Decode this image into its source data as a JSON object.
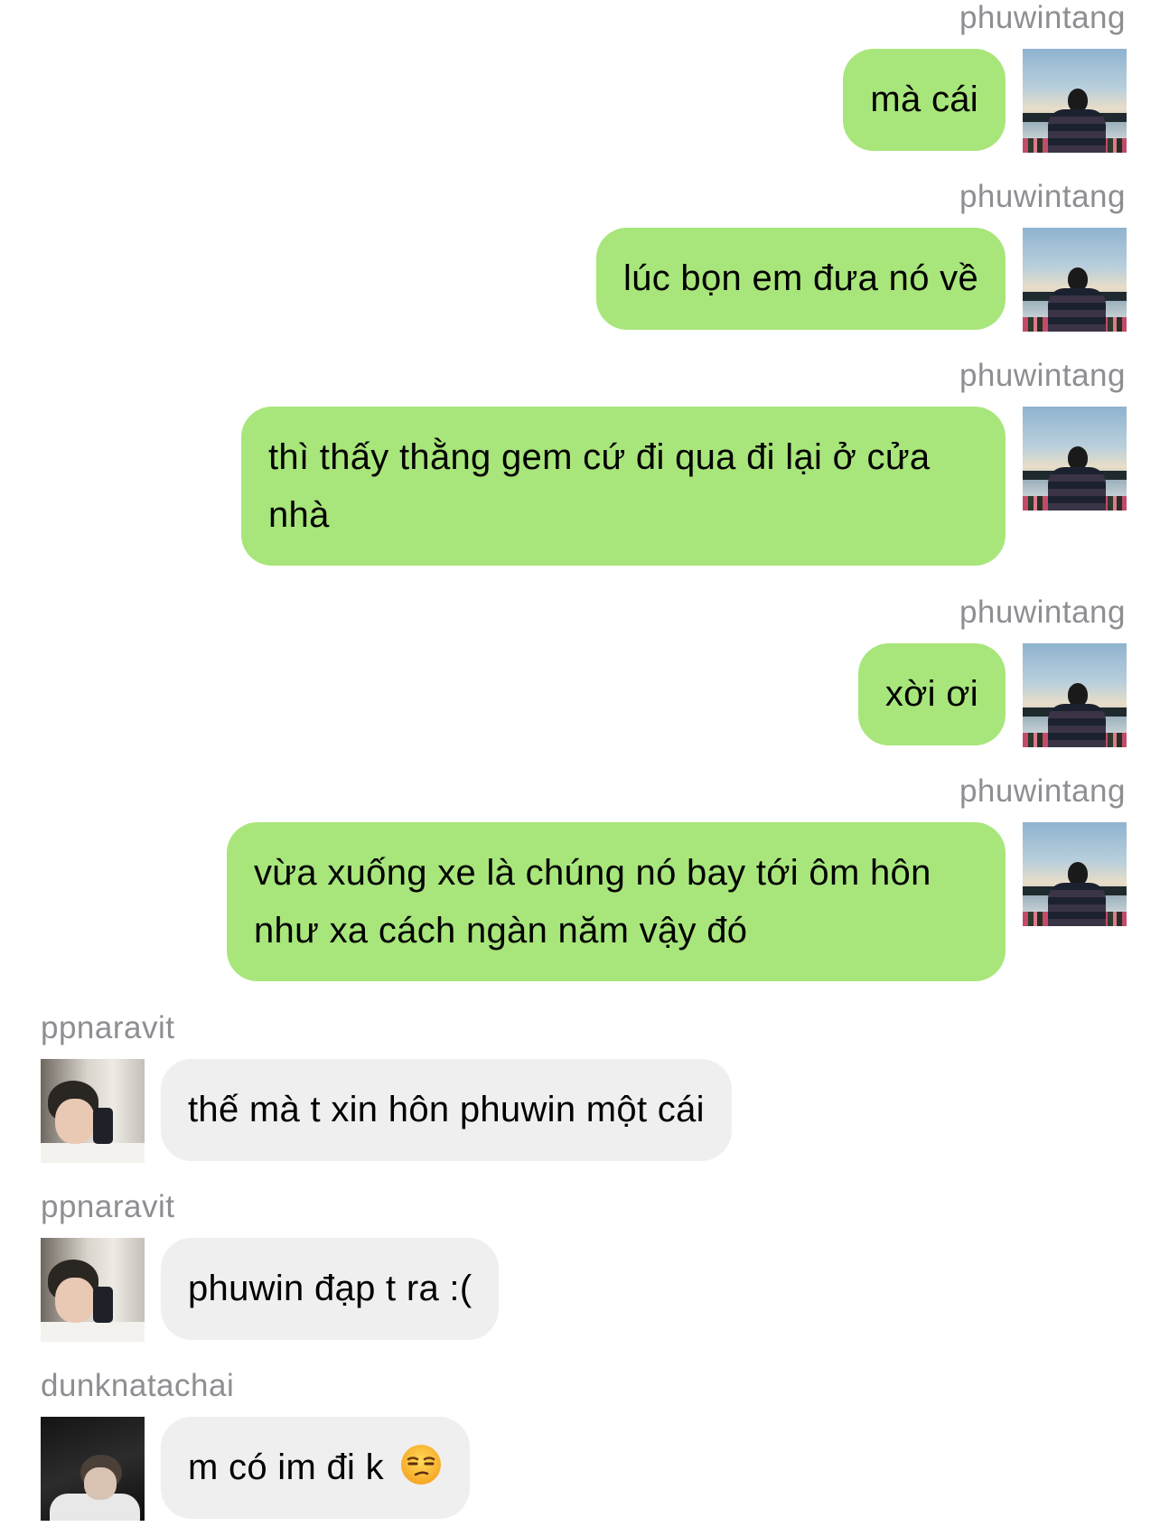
{
  "messages": [
    {
      "sender": "phuwintang",
      "direction": "outgoing",
      "text": "mà cái"
    },
    {
      "sender": "phuwintang",
      "direction": "outgoing",
      "text": "lúc bọn em đưa nó về"
    },
    {
      "sender": "phuwintang",
      "direction": "outgoing",
      "text": "thì thấy thằng gem cứ đi qua đi lại ở cửa nhà"
    },
    {
      "sender": "phuwintang",
      "direction": "outgoing",
      "text": "xời ơi"
    },
    {
      "sender": "phuwintang",
      "direction": "outgoing",
      "text": "vừa xuống xe là chúng nó bay tới ôm hôn như xa cách ngàn năm vậy đó"
    },
    {
      "sender": "ppnaravit",
      "direction": "incoming",
      "text": "thế mà t xin hôn phuwin một cái"
    },
    {
      "sender": "ppnaravit",
      "direction": "incoming",
      "text": "phuwin đạp t ra :("
    },
    {
      "sender": "dunknatachai",
      "direction": "incoming",
      "text": "m có im đi k",
      "emoji": "unamused-face-icon"
    }
  ],
  "colors": {
    "outgoing_bubble": "#a8e67b",
    "incoming_bubble": "#efefef",
    "username": "#8e8e93"
  }
}
